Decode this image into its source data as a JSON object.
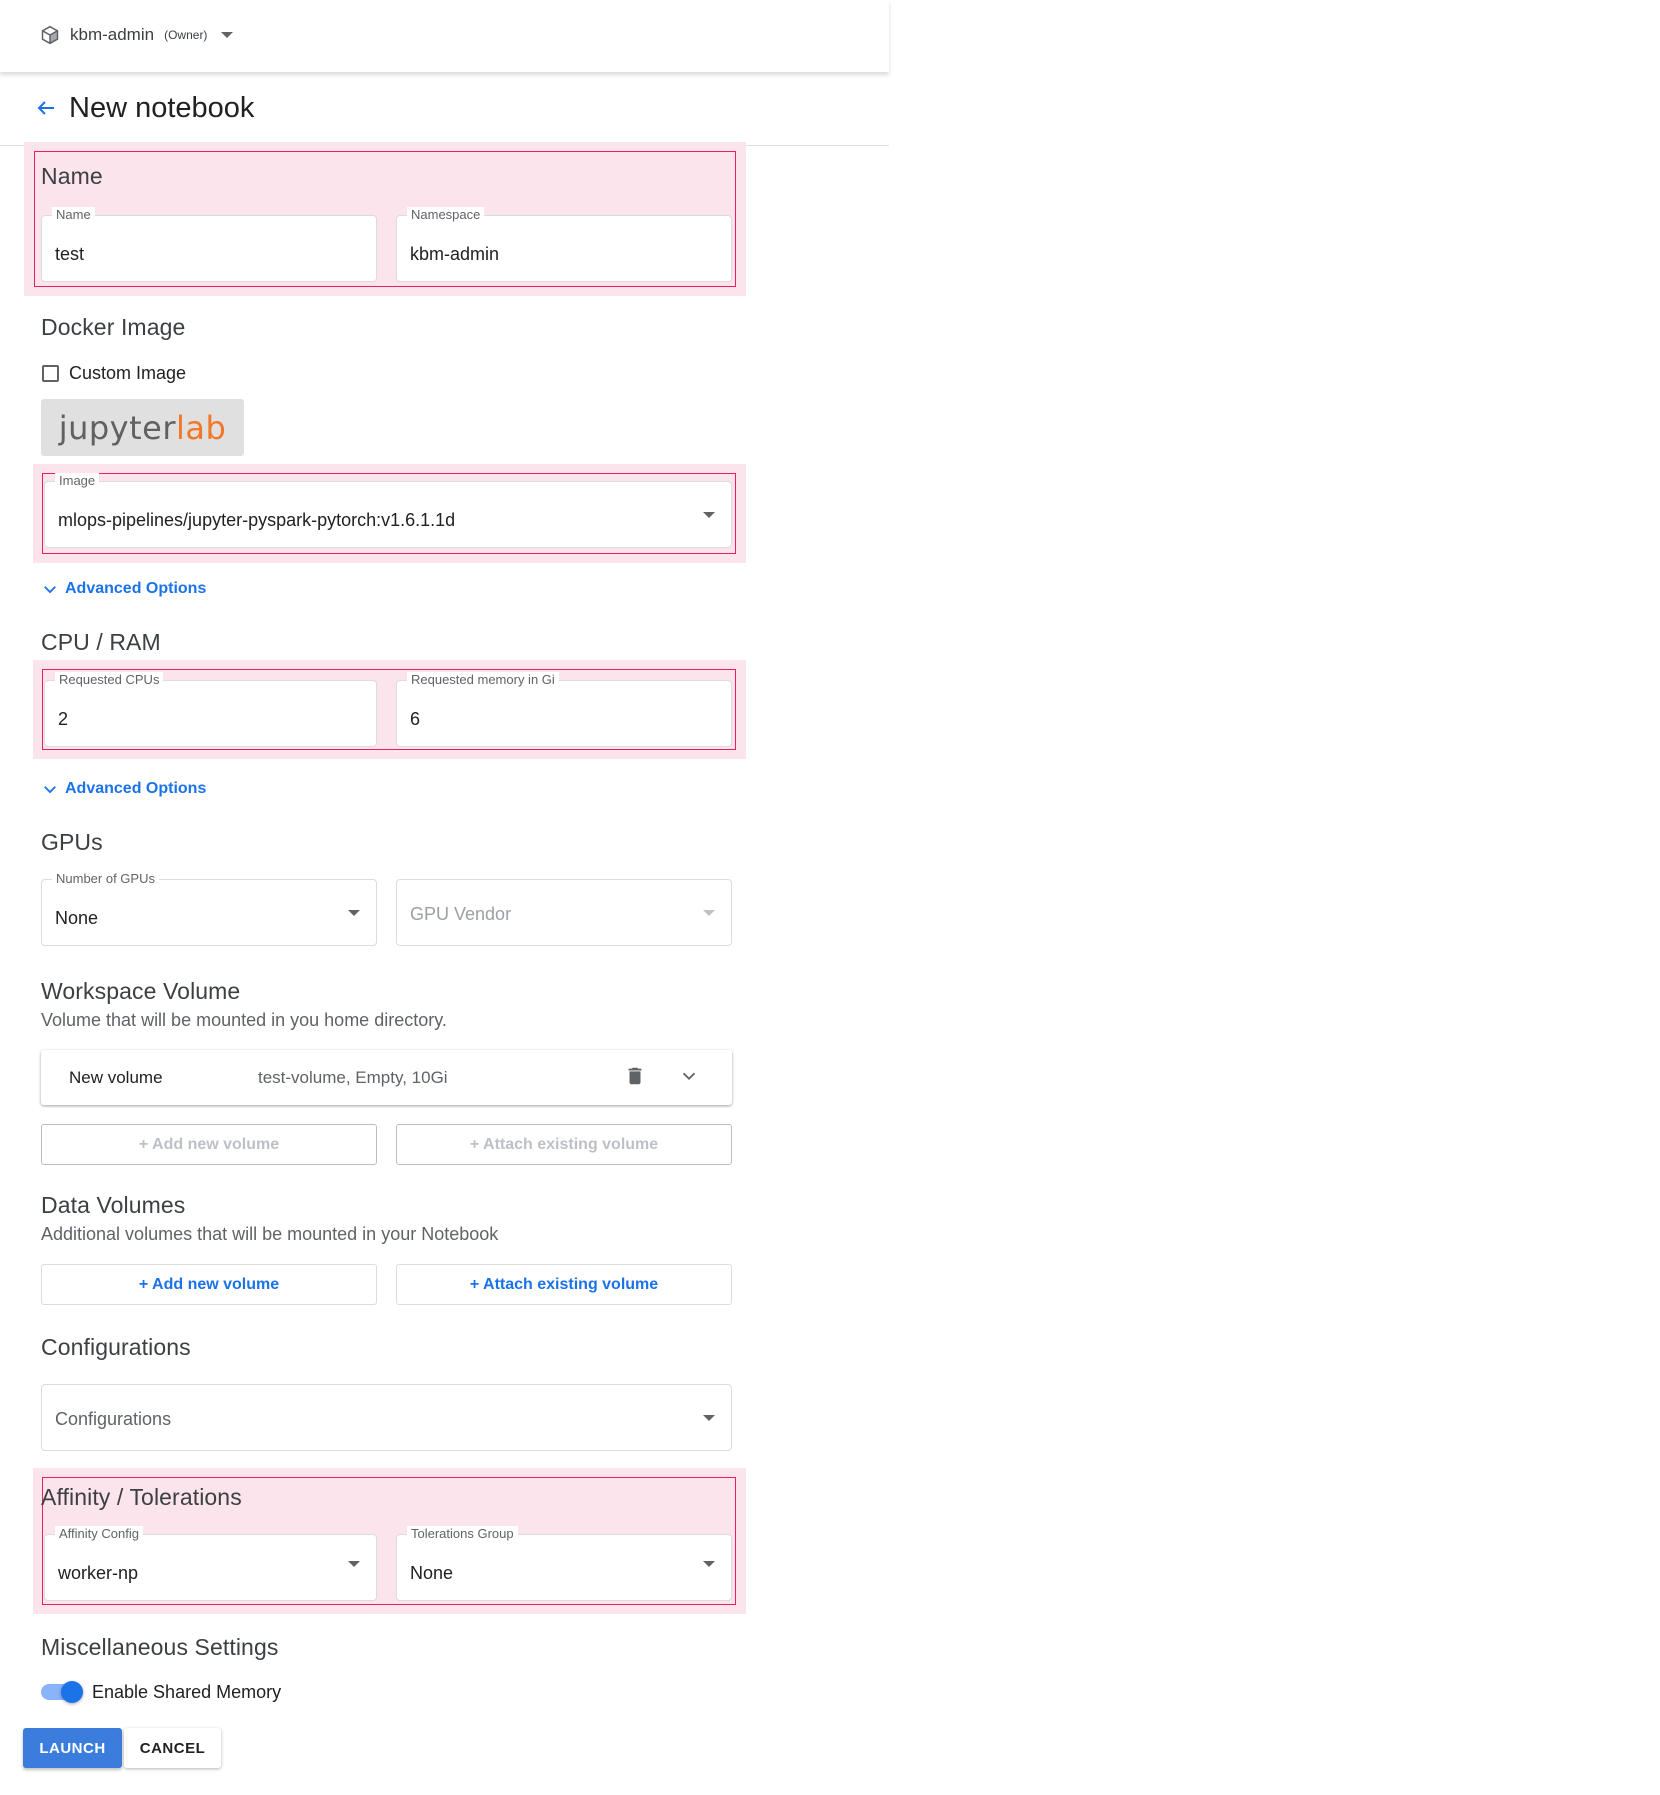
{
  "topbar": {
    "namespace": "kbm-admin",
    "role": "(Owner)"
  },
  "header": {
    "title": "New notebook"
  },
  "name_section": {
    "title": "Name",
    "name_label": "Name",
    "name_value": "test",
    "namespace_label": "Namespace",
    "namespace_value": "kbm-admin"
  },
  "docker_section": {
    "title": "Docker Image",
    "custom_image_label": "Custom Image",
    "logo_part1": "jupyter",
    "logo_part2": "lab",
    "image_label": "Image",
    "image_value": "mlops-pipelines/jupyter-pyspark-pytorch:v1.6.1.1d",
    "advanced_label": "Advanced Options"
  },
  "cpu_section": {
    "title": "CPU / RAM",
    "cpu_label": "Requested CPUs",
    "cpu_value": "2",
    "mem_label": "Requested memory in Gi",
    "mem_value": "6",
    "advanced_label": "Advanced Options"
  },
  "gpu_section": {
    "title": "GPUs",
    "num_label": "Number of GPUs",
    "num_value": "None",
    "vendor_placeholder": "GPU Vendor"
  },
  "workspace_section": {
    "title": "Workspace Volume",
    "description": "Volume that will be mounted in you home directory.",
    "volume_title": "New volume",
    "volume_summary": "test-volume, Empty, 10Gi",
    "add_new": "+ Add new volume",
    "attach_existing": "+ Attach existing volume"
  },
  "data_section": {
    "title": "Data Volumes",
    "description": "Additional volumes that will be mounted in your Notebook",
    "add_new": "+ Add new volume",
    "attach_existing": "+ Attach existing volume"
  },
  "config_section": {
    "title": "Configurations",
    "placeholder": "Configurations"
  },
  "affinity_section": {
    "title": "Affinity / Tolerations",
    "affinity_label": "Affinity Config",
    "affinity_value": "worker-np",
    "tolerations_label": "Tolerations Group",
    "tolerations_value": "None"
  },
  "misc_section": {
    "title": "Miscellaneous Settings",
    "shm_label": "Enable Shared Memory"
  },
  "footer": {
    "launch": "LAUNCH",
    "cancel": "CANCEL"
  },
  "colors": {
    "accent": "#1a73e8",
    "highlight_fill": "#fce4ec",
    "highlight_border": "#e91e63",
    "jupyter_orange": "#f37726"
  },
  "icons": {
    "namespace": "cube-icon",
    "back": "arrow-left-icon",
    "delete": "trash-icon",
    "expand": "chevron-down-icon"
  }
}
